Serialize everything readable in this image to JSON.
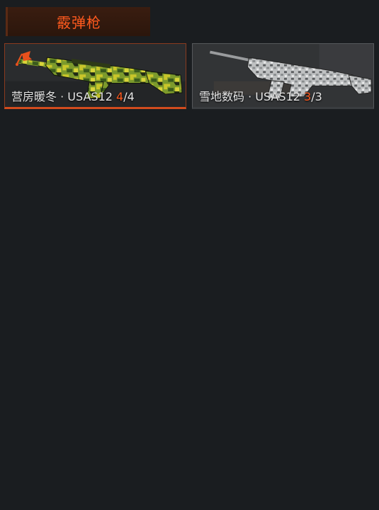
{
  "category": {
    "title": "霰弹枪"
  },
  "cards": [
    {
      "name": "营房暖冬",
      "weapon": "USAS12",
      "separator": "·",
      "progress_current": "4",
      "progress_slash": "/",
      "progress_total": "4",
      "selected": true,
      "skin": "green-camo",
      "badge_icon": "flag-icon"
    },
    {
      "name": "雪地数码",
      "weapon": "USAS12",
      "separator": "·",
      "progress_current": "3",
      "progress_slash": "/",
      "progress_total": "3",
      "selected": false,
      "skin": "snow-digital"
    }
  ],
  "colors": {
    "accent": "#ff5a1e",
    "background": "#1a1d20",
    "header_bg": "#3a1d10"
  }
}
